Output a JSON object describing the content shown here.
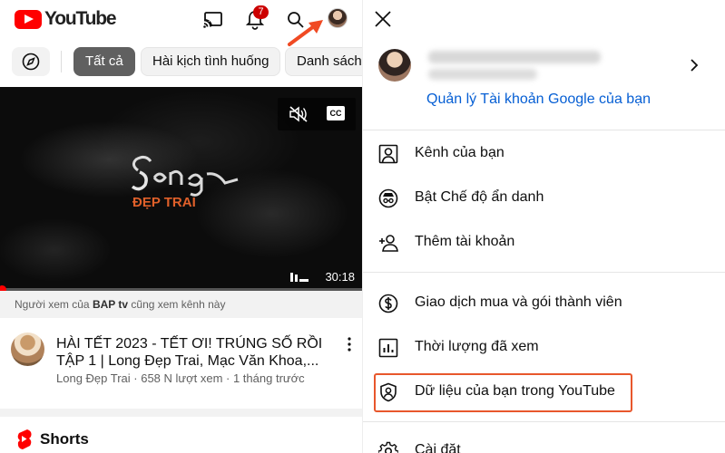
{
  "feed": {
    "logo_text": "YouTube",
    "notification_count": "7",
    "chips": [
      "Tất cả",
      "Hài kịch tình huống",
      "Danh sách"
    ],
    "video": {
      "duration": "30:18",
      "reason_prefix": "Người xem của ",
      "reason_channel": "BAP tv",
      "reason_suffix": " cũng xem kênh này",
      "title": "HÀI TẾT 2023 - TẾT ƠI! TRÚNG SỐ RỒI TẬP 1 | Long Đẹp Trai, Mạc Văn Khoa,...",
      "meta": "Long Đẹp Trai · 658 N lượt xem · 1 tháng trước"
    },
    "shorts_label": "Shorts"
  },
  "account": {
    "manage_link": "Quản lý Tài khoản Google của bạn",
    "menu": [
      {
        "label": "Kênh của bạn",
        "icon": "person-box-icon"
      },
      {
        "label": "Bật Chế độ ẩn danh",
        "icon": "incognito-icon"
      },
      {
        "label": "Thêm tài khoản",
        "icon": "add-person-icon"
      },
      {
        "label": "Giao dịch mua và gói thành viên",
        "icon": "dollar-circle-icon"
      },
      {
        "label": "Thời lượng đã xem",
        "icon": "bar-chart-icon"
      },
      {
        "label": "Dữ liệu của bạn trong YouTube",
        "icon": "shield-person-icon"
      },
      {
        "label": "Cài đặt",
        "icon": "gear-icon"
      }
    ]
  },
  "colors": {
    "brand_red": "#ff0000",
    "link_blue": "#065fd4",
    "highlight_orange": "#e8572c"
  }
}
